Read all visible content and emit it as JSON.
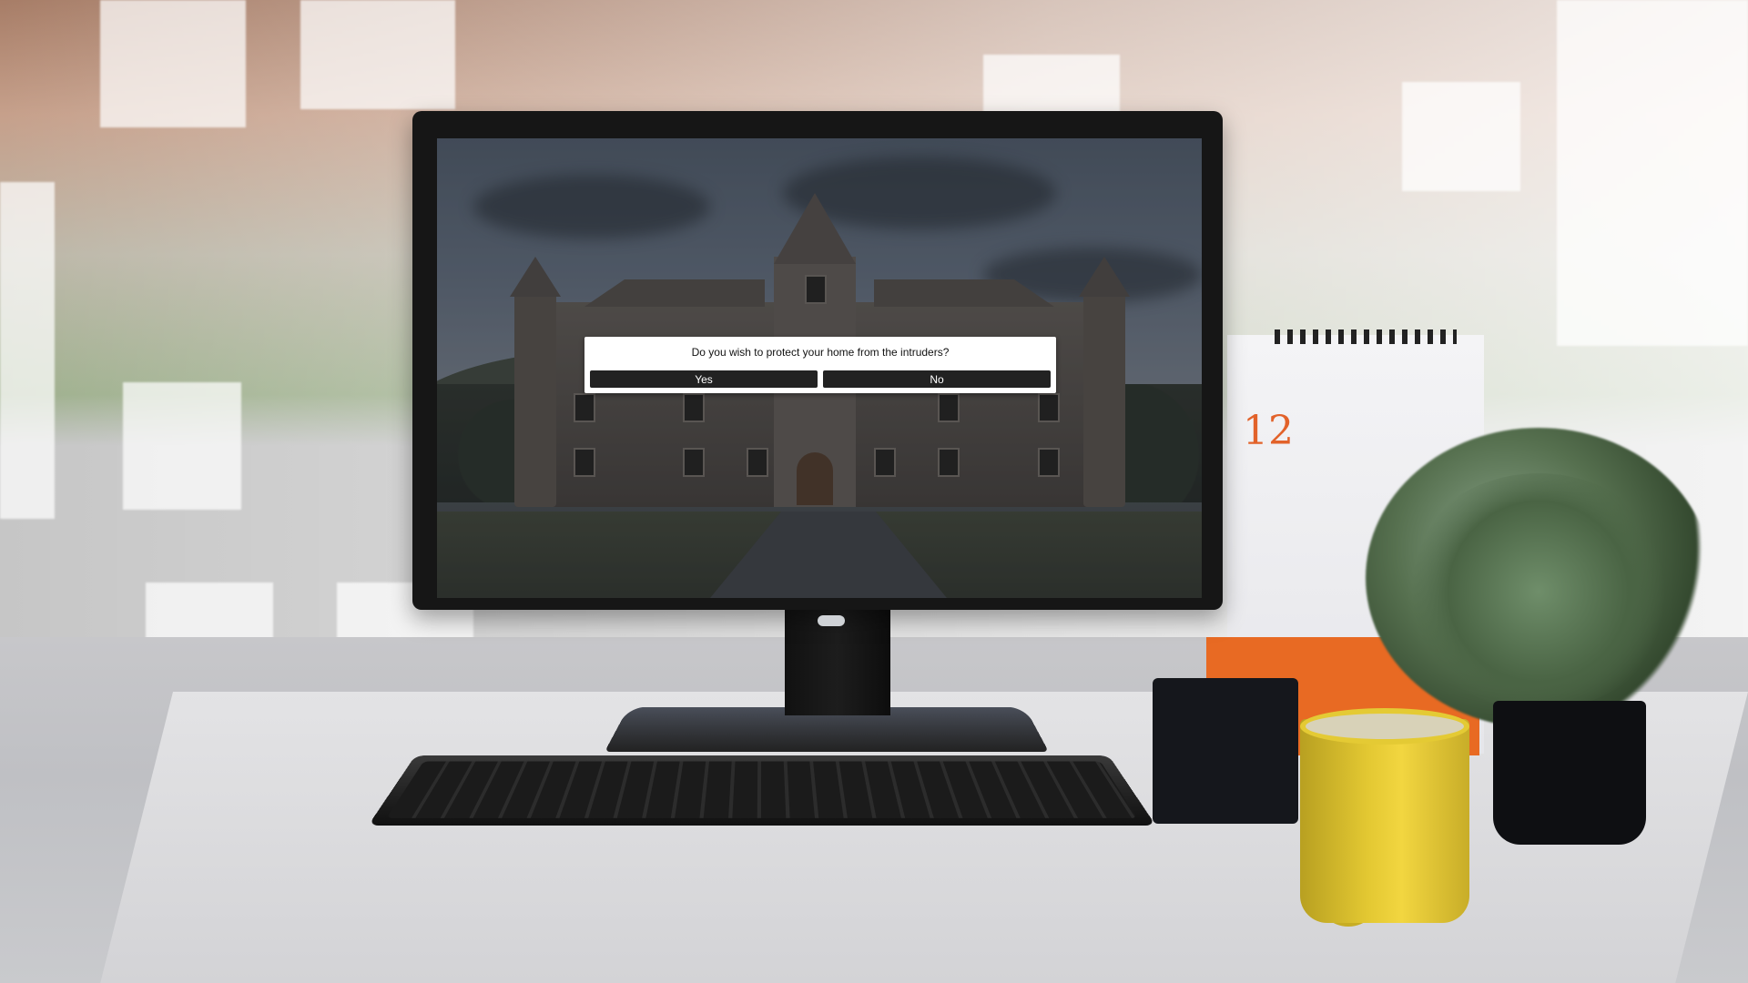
{
  "dialog": {
    "question": "Do you wish to protect your home from the intruders?",
    "yes_label": "Yes",
    "no_label": "No"
  },
  "calendar": {
    "day_number": "12"
  },
  "colors": {
    "dialog_bg": "#ffffff",
    "button_bg": "#222222",
    "button_text": "#ffffff",
    "mug": "#e3c832",
    "calendar_accent": "#e2622a"
  }
}
